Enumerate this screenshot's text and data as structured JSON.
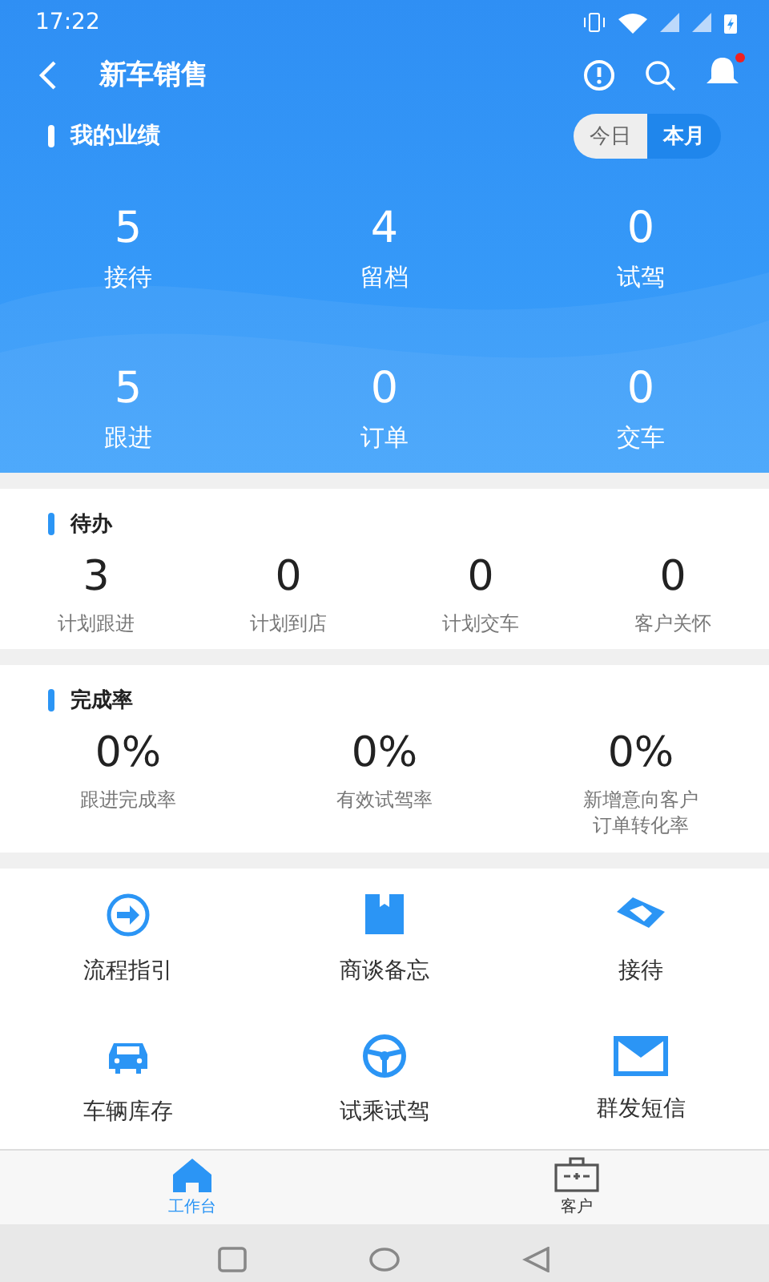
{
  "status_bar": {
    "time": "17:22"
  },
  "toolbar": {
    "title": "新车销售",
    "notification_dot": true
  },
  "performance": {
    "title": "我的业绩",
    "periods": [
      {
        "label": "今日",
        "selected": false
      },
      {
        "label": "本月",
        "selected": true
      }
    ],
    "stats": [
      {
        "value": "5",
        "label": "接待"
      },
      {
        "value": "4",
        "label": "留档"
      },
      {
        "value": "0",
        "label": "试驾"
      },
      {
        "value": "5",
        "label": "跟进"
      },
      {
        "value": "0",
        "label": "订单"
      },
      {
        "value": "0",
        "label": "交车"
      }
    ]
  },
  "todo": {
    "title": "待办",
    "items": [
      {
        "value": "3",
        "label": "计划跟进"
      },
      {
        "value": "0",
        "label": "计划到店"
      },
      {
        "value": "0",
        "label": "计划交车"
      },
      {
        "value": "0",
        "label": "客户关怀"
      }
    ]
  },
  "completion": {
    "title": "完成率",
    "items": [
      {
        "value": "0%",
        "label": "跟进完成率"
      },
      {
        "value": "0%",
        "label": "有效试驾率"
      },
      {
        "value": "0%",
        "label": "新增意向客户订单转化率"
      }
    ]
  },
  "shortcuts": [
    {
      "kind": "guide",
      "label": "流程指引"
    },
    {
      "kind": "memo",
      "label": "商谈备忘"
    },
    {
      "kind": "reception",
      "label": "接待"
    },
    {
      "kind": "car",
      "label": "车辆库存"
    },
    {
      "kind": "wheel",
      "label": "试乘试驾"
    },
    {
      "kind": "mail",
      "label": "群发短信"
    }
  ],
  "bottom_tabs": [
    {
      "kind": "home",
      "label": "工作台",
      "selected": true
    },
    {
      "kind": "case",
      "label": "客户",
      "selected": false
    }
  ]
}
